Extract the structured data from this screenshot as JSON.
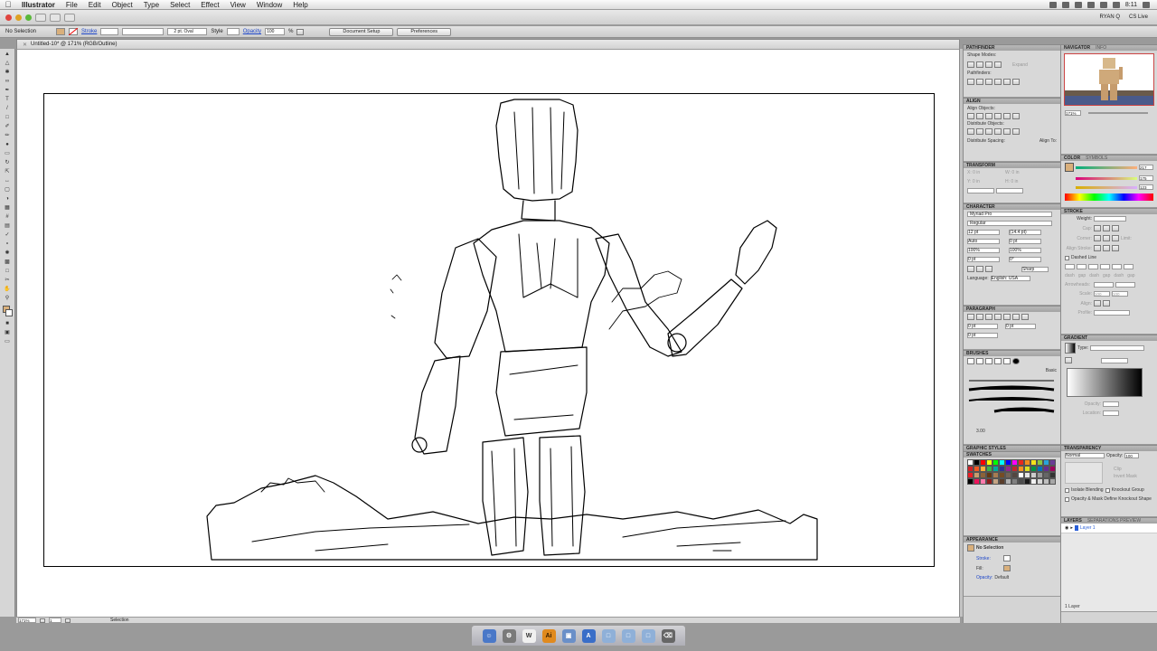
{
  "menubar": {
    "apple": "",
    "items": [
      "Illustrator",
      "File",
      "Edit",
      "Object",
      "Type",
      "Select",
      "Effect",
      "View",
      "Window",
      "Help"
    ],
    "user": "RYAN Q",
    "time": "8:11",
    "cs_live": "CS Live"
  },
  "control": {
    "selection": "No Selection",
    "stroke_label": "Stroke",
    "brush": "2 pt. Oval",
    "style_label": "Style",
    "opacity_label": "Opacity",
    "opacity_value": "100",
    "percent": "%",
    "doc_setup": "Document Setup",
    "preferences": "Preferences"
  },
  "document": {
    "tab_title": "Untitled-10* @ 171% (RGB/Outline)",
    "zoom": "171%",
    "page": "1",
    "status": "Selection"
  },
  "panels": {
    "pathfinder": "PATHFINDER",
    "shape_modes": "Shape Modes:",
    "expand": "Expand",
    "pathfinders": "Pathfinders:",
    "align": "ALIGN",
    "align_objects": "Align Objects:",
    "distribute_objects": "Distribute Objects:",
    "distribute_spacing": "Distribute Spacing:",
    "align_to": "Align To:",
    "transform": "TRANSFORM",
    "x": "X: 0 in",
    "y": "Y: 0 in",
    "w": "W: 0 in",
    "h": "H: 0 in",
    "character": "CHARACTER",
    "font": "Myriad Pro",
    "font_style": "Regular",
    "size": "12 pt",
    "leading": "(14.4 pt)",
    "auto": "Auto",
    "scale_h": "100%",
    "scale_v": "100%",
    "zero_pt": "0 pt",
    "zero_deg": "0°",
    "sharp": "Sharp",
    "language_label": "Language:",
    "language": "English: USA",
    "paragraph": "PARAGRAPH",
    "brushes": "BRUSHES",
    "basic": "Basic",
    "brush_size": "3.00",
    "graphic_styles": "GRAPHIC STYLES",
    "swatches": "SWATCHES",
    "appearance": "APPEARANCE",
    "ap_selection": "No Selection",
    "ap_stroke": "Stroke:",
    "ap_fill": "Fill:",
    "ap_opacity": "Opacity:",
    "ap_default": "Default",
    "navigator": "NAVIGATOR",
    "info": "INFO",
    "nav_zoom": "171%",
    "color": "COLOR",
    "symbols": "SYMBOLS",
    "r_val": "217",
    "g_val": "175",
    "b_val": "123",
    "stroke": "STROKE",
    "weight_label": "Weight:",
    "cap": "Cap:",
    "corner": "Corner:",
    "limit": "Limit:",
    "align_stroke": "Align Stroke:",
    "dashed_line": "Dashed Line",
    "dash": "dash",
    "gap": "gap",
    "arrowheads": "Arrowheads:",
    "scale": "Scale:",
    "scale_v1": "100",
    "scale_v2": "100",
    "align_label": "Align:",
    "profile": "Profile:",
    "gradient": "GRADIENT",
    "type_label": "Type:",
    "opacity_lbl": "Opacity:",
    "location_lbl": "Location:",
    "transparency": "TRANSPARENCY",
    "blend_mode": "Normal",
    "trans_opacity": "100",
    "clip": "Clip",
    "invert_mask": "Invert Mask",
    "isolate_blending": "Isolate Blending",
    "knockout_group": "Knockout Group",
    "opacity_mask_note": "Opacity & Mask Define Knockout Shape",
    "layers": "LAYERS",
    "sep_preview": "SEPARATIONS PREVIEW",
    "layer1": "Layer 1",
    "layer_count": "1 Layer"
  },
  "colors": {
    "fill_swatch": "#d9af7b",
    "accent": "#2a5fd8",
    "dock_ai": "#e08a1e"
  },
  "swatch_colors": [
    "#ffffff",
    "#000000",
    "#ff0000",
    "#ffff00",
    "#00ff00",
    "#00ffff",
    "#0000ff",
    "#ff00ff",
    "#e8271f",
    "#f28c1e",
    "#f6e21b",
    "#8cc63f",
    "#29a4d9",
    "#6a3c96",
    "#d12127",
    "#f15a24",
    "#fbb03b",
    "#39b54a",
    "#00a99d",
    "#2e3192",
    "#93278f",
    "#c1272d",
    "#f7931e",
    "#d9e021",
    "#009245",
    "#0071bc",
    "#662d91",
    "#9e005d",
    "#ed1c24",
    "#c69c6d",
    "#8c6239",
    "#603813",
    "#a67c52",
    "#754c24",
    "#736357",
    "#534741",
    "#ffffff",
    "#e6e6e6",
    "#cccccc",
    "#999999",
    "#666666",
    "#333333",
    "#000000",
    "#ed145b",
    "#ff7bac",
    "#8e1b1b",
    "#c4a484",
    "#5a3e2b",
    "#b3b3b3",
    "#808080",
    "#4d4d4d",
    "#1a1a1a",
    "#f2f2f2",
    "#d9d9d9",
    "#bfbfbf",
    "#a6a6a6"
  ]
}
